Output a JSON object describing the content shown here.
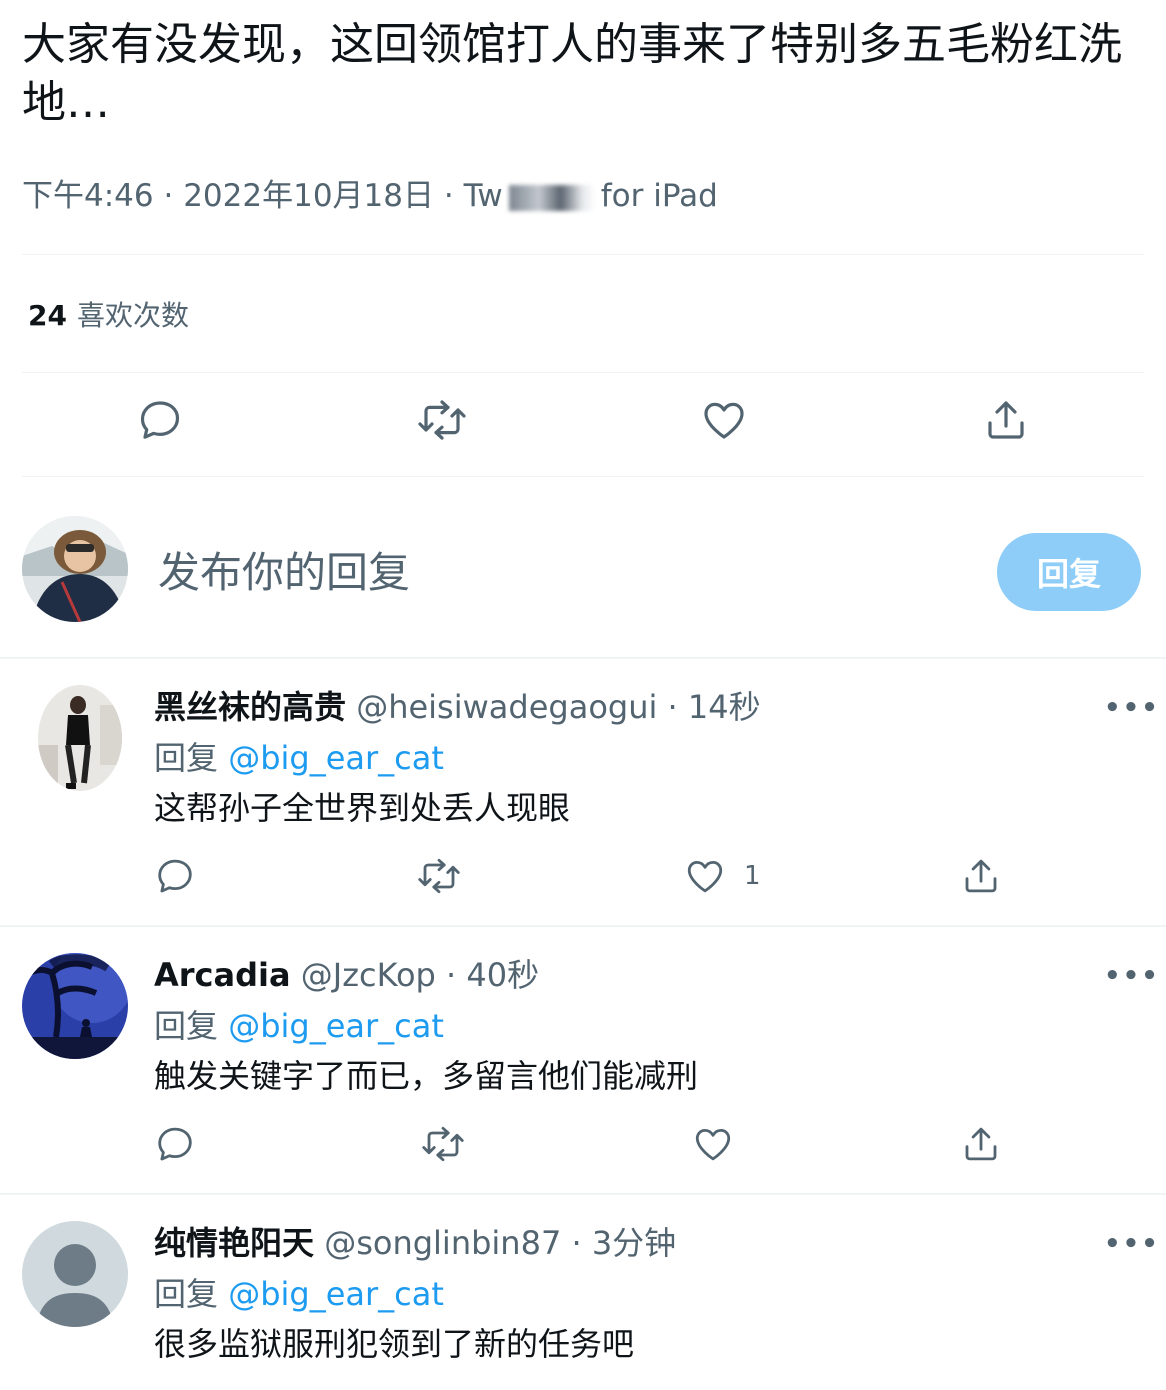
{
  "tweet": {
    "text": "大家有没发现，这回领馆打人的事来了特别多五毛粉红洗地…",
    "time": "下午4:46",
    "sep": "·",
    "date": "2022年10月18日",
    "source_start": "Tw",
    "source_end": "for iPad",
    "likes_count": "24",
    "likes_label": "喜欢次数"
  },
  "compose": {
    "placeholder": "发布你的回复",
    "button_label": "回复"
  },
  "replies": [
    {
      "name": "黑丝袜的高贵",
      "handle": "@heisiwadegaogui",
      "time": "14秒",
      "reply_prefix": "回复",
      "reply_to": "@big_ear_cat",
      "text": "这帮孙子全世界到处丢人现眼",
      "like_count": "1"
    },
    {
      "name": "Arcadia",
      "handle": "@JzcKop",
      "time": "40秒",
      "reply_prefix": "回复",
      "reply_to": "@big_ear_cat",
      "text": "触发关键字了而已，多留言他们能减刑",
      "like_count": ""
    },
    {
      "name": "纯情艳阳天",
      "handle": "@songlinbin87",
      "time": "3分钟",
      "reply_prefix": "回复",
      "reply_to": "@big_ear_cat",
      "text": "很多监狱服刑犯领到了新的任务吧",
      "like_count": ""
    }
  ],
  "more_label": "•••",
  "colors": {
    "accent": "#1d9bf0",
    "reply_button_disabled": "#8ecdf8",
    "secondary_text": "#536471",
    "divider": "#eff3f4"
  },
  "icons": [
    "reply-icon",
    "retweet-icon",
    "like-icon",
    "share-icon",
    "more-icon",
    "default-avatar-icon"
  ]
}
